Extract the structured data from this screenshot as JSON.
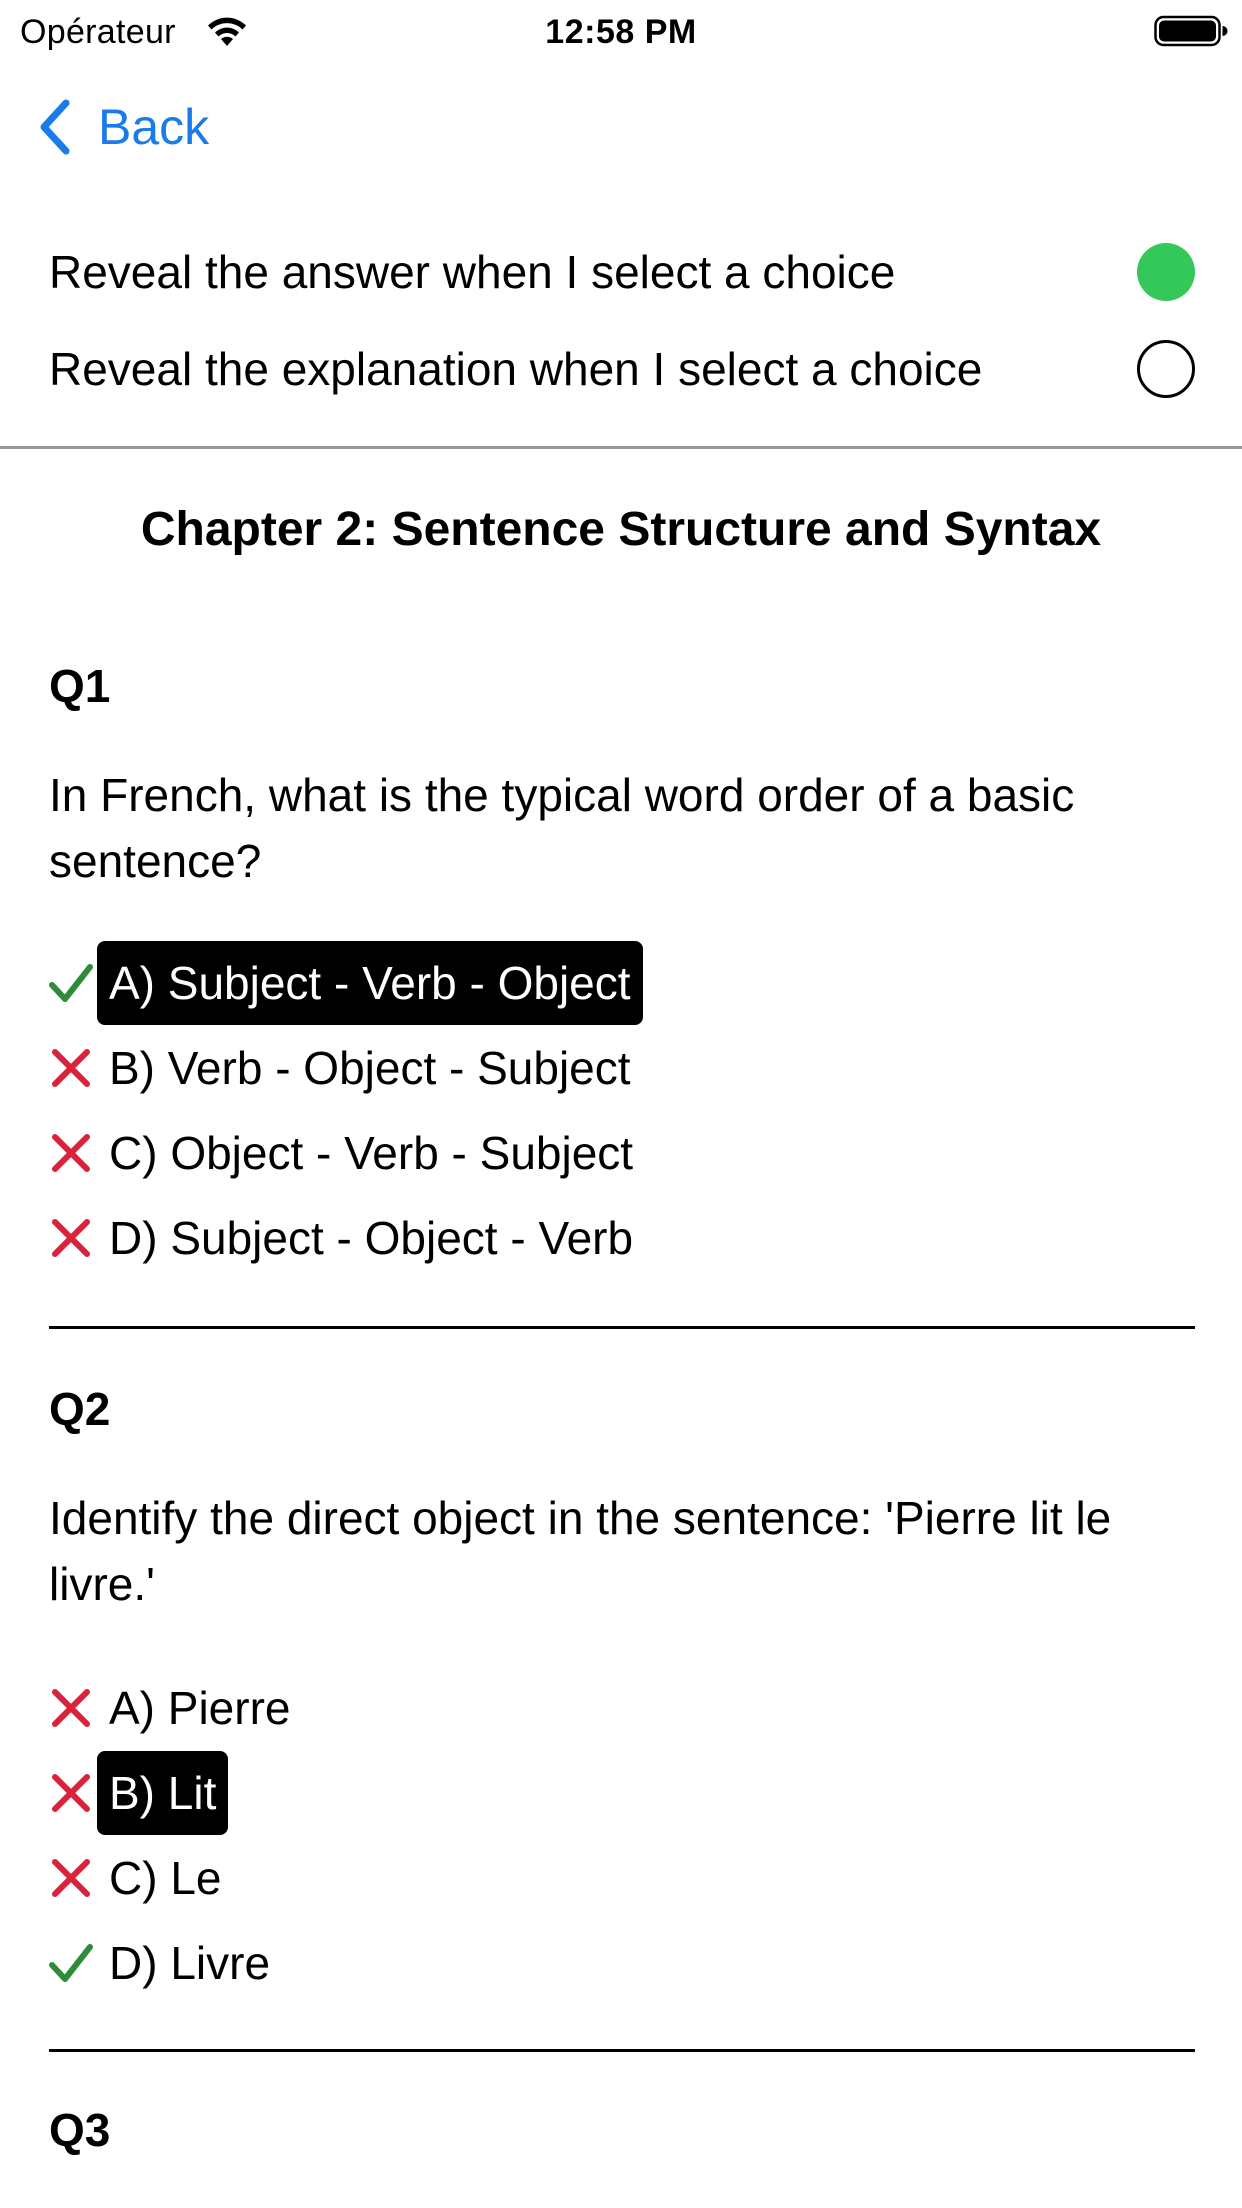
{
  "status_bar": {
    "carrier": "Opérateur",
    "time": "12:58 PM"
  },
  "nav": {
    "back_label": "Back"
  },
  "settings": [
    {
      "label": "Reveal the answer when I select a choice",
      "enabled": true
    },
    {
      "label": "Reveal the explanation when I select a choice",
      "enabled": false
    }
  ],
  "colors": {
    "accent": "#1a7bea",
    "toggle_on": "#34c759",
    "correct_mark": "#2e8b3a",
    "wrong_mark": "#d9233d",
    "selected_bg": "#000000"
  },
  "chapter": {
    "title": "Chapter 2: Sentence Structure and Syntax"
  },
  "questions": [
    {
      "number": "Q1",
      "text": "In French, what is the typical word order of a basic sentence?",
      "choices": [
        {
          "label": "A) Subject - Verb - Object",
          "mark": "check-icon",
          "selected": true
        },
        {
          "label": "B) Verb - Object - Subject",
          "mark": "cross-icon",
          "selected": false
        },
        {
          "label": "C) Object - Verb - Subject",
          "mark": "cross-icon",
          "selected": false
        },
        {
          "label": "D) Subject - Object - Verb",
          "mark": "cross-icon",
          "selected": false
        }
      ]
    },
    {
      "number": "Q2",
      "text": "Identify the direct object in the sentence: 'Pierre lit le livre.'",
      "choices": [
        {
          "label": "A) Pierre",
          "mark": "cross-icon",
          "selected": false
        },
        {
          "label": "B) Lit",
          "mark": "cross-icon",
          "selected": true
        },
        {
          "label": "C) Le",
          "mark": "cross-icon",
          "selected": false
        },
        {
          "label": "D) Livre",
          "mark": "check-icon",
          "selected": false
        }
      ]
    },
    {
      "number": "Q3"
    }
  ]
}
